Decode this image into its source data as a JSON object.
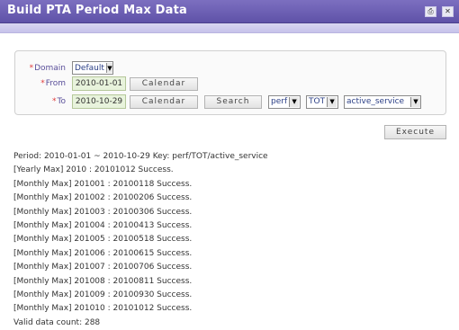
{
  "window": {
    "title": "Build PTA Period Max Data",
    "icons": [
      "printer-icon",
      "close-icon"
    ]
  },
  "form": {
    "domain_label": "Domain",
    "domain_value": "Default",
    "from_label": "From",
    "from_value": "2010-01-01",
    "to_label": "To",
    "to_value": "2010-10-29",
    "calendar_label": "Calendar",
    "search_label": "Search",
    "perf_value": "perf",
    "tot_value": "TOT",
    "service_value": "active_service",
    "required_mark": "*"
  },
  "execute_label": "Execute",
  "log": [
    "Period: 2010-01-01 ~ 2010-10-29 Key: perf/TOT/active_service",
    "[Yearly Max] 2010 : 20101012 Success.",
    "[Monthly Max] 201001 : 20100118 Success.",
    "[Monthly Max] 201002 : 20100206 Success.",
    "[Monthly Max] 201003 : 20100306 Success.",
    "[Monthly Max] 201004 : 20100413 Success.",
    "[Monthly Max] 201005 : 20100518 Success.",
    "[Monthly Max] 201006 : 20100615 Success.",
    "[Monthly Max] 201007 : 20100706 Success.",
    "[Monthly Max] 201008 : 20100811 Success.",
    "[Monthly Max] 201009 : 20100930 Success.",
    "[Monthly Max] 201010 : 20101012 Success.",
    "Valid data count: 288"
  ]
}
